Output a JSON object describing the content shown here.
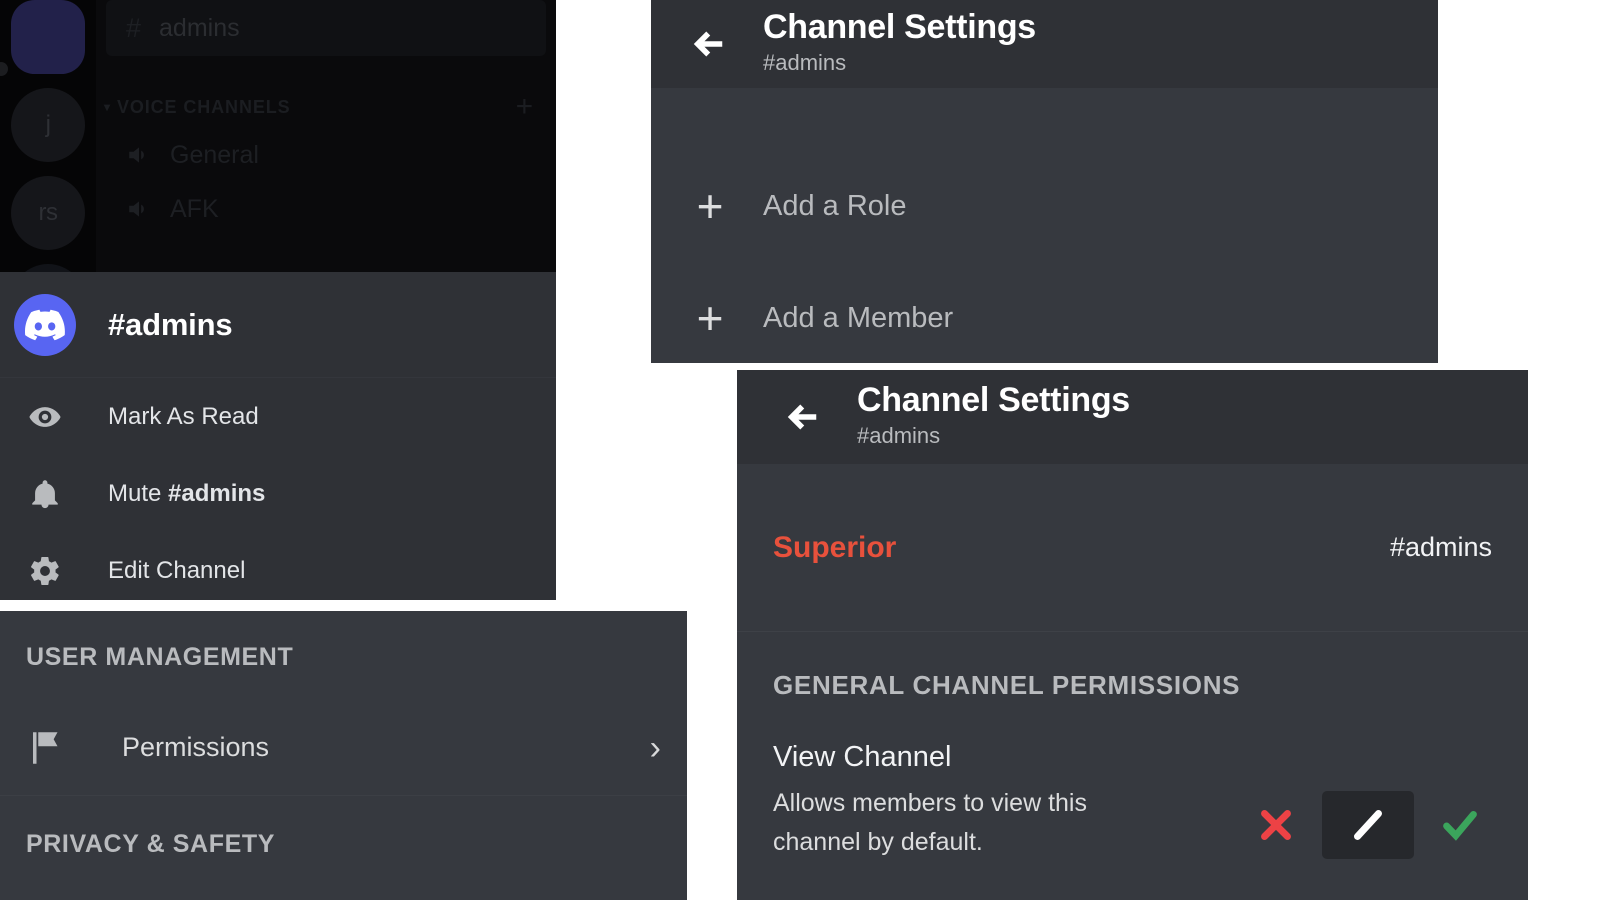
{
  "app": {
    "servers": [
      {
        "label": "",
        "state": "active"
      },
      {
        "label": "j",
        "state": "idle"
      },
      {
        "label": "rs",
        "state": "idle"
      },
      {
        "label": "+",
        "state": "add"
      }
    ],
    "selected_channel": {
      "hash": "#",
      "name": "admins"
    },
    "voice_category": {
      "label": "VOICE CHANNELS",
      "arrow": "chevron-down",
      "add": "+"
    },
    "voice_channels": [
      "General",
      "AFK"
    ]
  },
  "context_menu": {
    "title": "#admins",
    "items": [
      {
        "icon": "eye-icon",
        "label": "Mark As Read",
        "bold_suffix": ""
      },
      {
        "icon": "bell-icon",
        "label": "Mute ",
        "bold_suffix": "#admins"
      },
      {
        "icon": "gear-icon",
        "label": "Edit Channel",
        "bold_suffix": ""
      }
    ]
  },
  "settings_list": {
    "section_one": "USER MANAGEMENT",
    "permissions_item": {
      "label": "Permissions",
      "icon": "flag-icon",
      "chevron": "›"
    },
    "section_two": "PRIVACY & SAFETY"
  },
  "channel_settings_top": {
    "back_icon": "arrow-left-icon",
    "title": "Channel Settings",
    "subtitle": "#admins",
    "rows": [
      {
        "plus": "+",
        "label": "Add a Role"
      },
      {
        "plus": "+",
        "label": "Add a Member"
      }
    ]
  },
  "channel_settings_bottom": {
    "back_icon": "arrow-left-icon",
    "title": "Channel Settings",
    "subtitle": "#admins",
    "role": {
      "name": "Superior",
      "color": "#e8513c",
      "channel": "#admins"
    },
    "permissions_header": "GENERAL CHANNEL PERMISSIONS",
    "permission": {
      "name": "View Channel",
      "description": "Allows members to view this channel by default.",
      "toggle_selected": "neutral",
      "options": [
        {
          "id": "deny",
          "icon": "cross-icon",
          "color": "#ed4245"
        },
        {
          "id": "neutral",
          "icon": "slash-icon",
          "color": "#ffffff"
        },
        {
          "id": "allow",
          "icon": "check-icon",
          "color": "#3ba55c"
        }
      ]
    }
  }
}
